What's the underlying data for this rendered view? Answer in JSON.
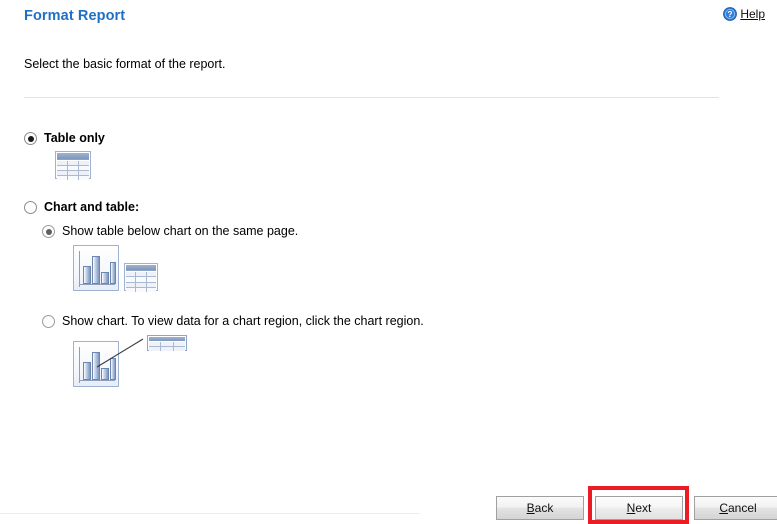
{
  "header": {
    "title": "Format Report",
    "help_label": "Help",
    "help_icon": "help-circle-icon"
  },
  "instruction": "Select the basic format of the report.",
  "options": [
    {
      "id": "table-only",
      "label": "Table only",
      "selected": true,
      "bold": true,
      "icon": "table-icon"
    },
    {
      "id": "chart-and-table",
      "label": "Chart and table:",
      "selected": false,
      "bold": true,
      "sub_options": [
        {
          "id": "table-below-chart",
          "label": "Show table below chart on the same page.",
          "selected": true,
          "icons": [
            "bar-chart-icon",
            "table-icon"
          ]
        },
        {
          "id": "chart-drilldown",
          "label": "Show chart. To view data for a chart region, click the chart region.",
          "selected": false,
          "icons": [
            "bar-chart-icon",
            "connector-line-icon",
            "mini-table-icon"
          ]
        }
      ]
    }
  ],
  "footer": {
    "back": {
      "prefix": "",
      "mnemonic": "B",
      "suffix": "ack"
    },
    "next": {
      "prefix": "",
      "mnemonic": "N",
      "suffix": "ext"
    },
    "cancel": {
      "prefix": "",
      "mnemonic": "C",
      "suffix": "ancel"
    }
  },
  "colors": {
    "title": "#1f6fc4",
    "highlight": "#ed1c24",
    "icon_blue": "#7f97bd",
    "divider": "#e4e4e4"
  }
}
